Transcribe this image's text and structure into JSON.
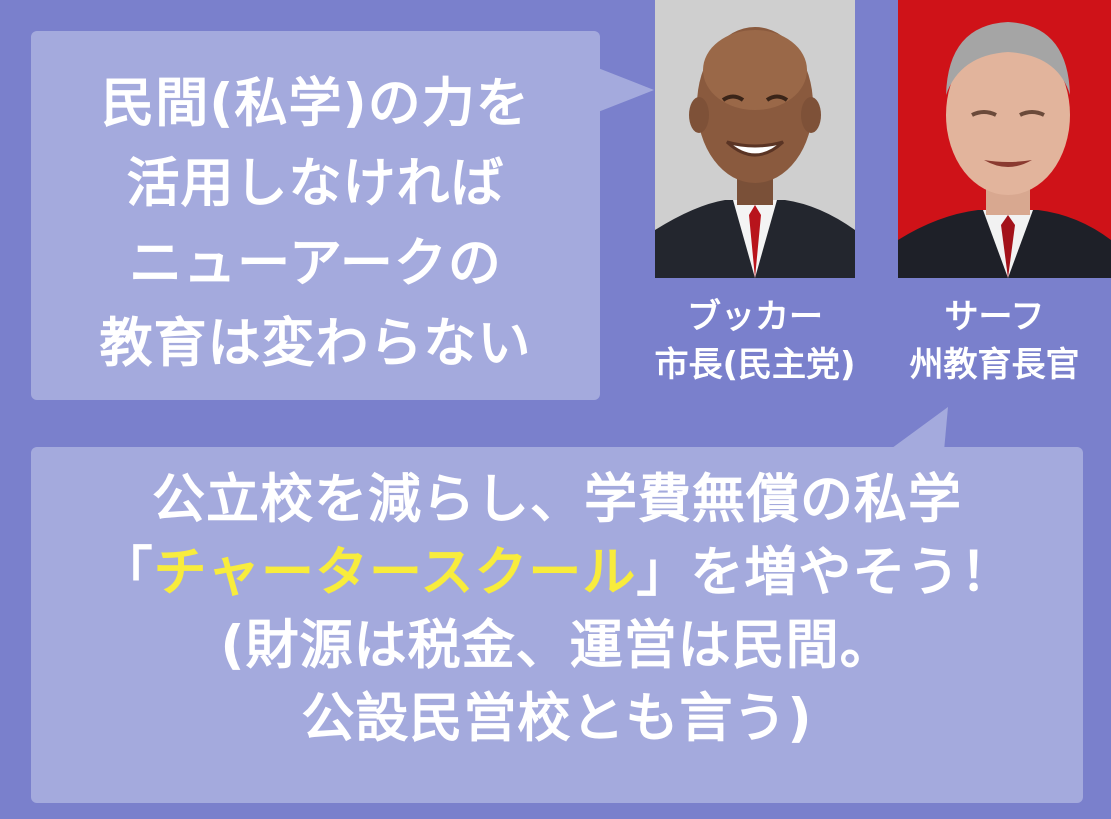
{
  "top_bubble": {
    "lines": [
      "民間(私学)の力を",
      "活用しなければ",
      "ニューアークの",
      "教育は変わらない"
    ]
  },
  "bottom_bubble": {
    "line1": "公立校を減らし、学費無償の私学",
    "line2_open": "「",
    "line2_highlight": "チャータースクール",
    "line2_close": "」を増やそう！",
    "line3": "(財源は税金、運営は民間。",
    "line4": "公設民営校とも言う)"
  },
  "people": [
    {
      "name": "ブッカー",
      "title": "市長(民主党)"
    },
    {
      "name": "サーフ",
      "title": "州教育長官"
    }
  ],
  "colors": {
    "background": "#7a80cc",
    "bubble": "#a4aadd",
    "text": "#ffffff",
    "highlight": "#f8ec3c"
  }
}
